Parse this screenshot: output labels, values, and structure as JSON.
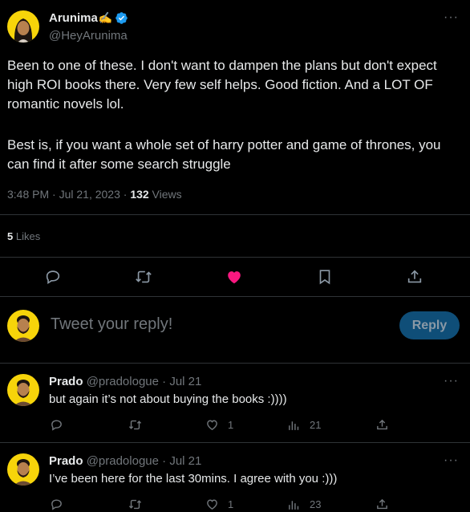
{
  "tweet": {
    "author_name": "Arunima",
    "author_emoji": "✍️",
    "handle": "@HeyArunima",
    "text_p1": "Been to one of these. I don't want to dampen the plans but don't expect high ROI books there. Very few self helps. Good fiction. And a LOT OF romantic novels lol.",
    "text_p2": "Best is, if you want a whole set of harry potter and game of thrones, you can find it after some search struggle",
    "timestamp": "3:48 PM · Jul 21, 2023 · ",
    "views_count": "132",
    "views_label": " Views",
    "likes_count": "5",
    "likes_label": " Likes"
  },
  "composer": {
    "placeholder": "Tweet your reply!",
    "reply_label": "Reply"
  },
  "replies": [
    {
      "name": "Prado",
      "handle": "@pradologue",
      "date": "Jul 21",
      "separator": " · ",
      "text": "but again it’s not about buying the books :))))",
      "likes": "1",
      "views": "21"
    },
    {
      "name": "Prado",
      "handle": "@pradologue",
      "date": "Jul 21",
      "separator": " · ",
      "text": "I’ve been here for the last 30mins. I agree with you :)))",
      "likes": "1",
      "views": "23"
    }
  ],
  "colors": {
    "background": "#000000",
    "text": "#e7e9ea",
    "muted": "#71767b",
    "verified": "#1d9bf0",
    "like_active": "#f91880",
    "reply_button": "#0f4e78",
    "avatar_bg": "#f7d40a"
  },
  "icons": [
    "verified-badge-icon",
    "more-icon",
    "reply-icon",
    "retweet-icon",
    "like-icon",
    "bookmark-icon",
    "share-icon",
    "views-icon"
  ]
}
